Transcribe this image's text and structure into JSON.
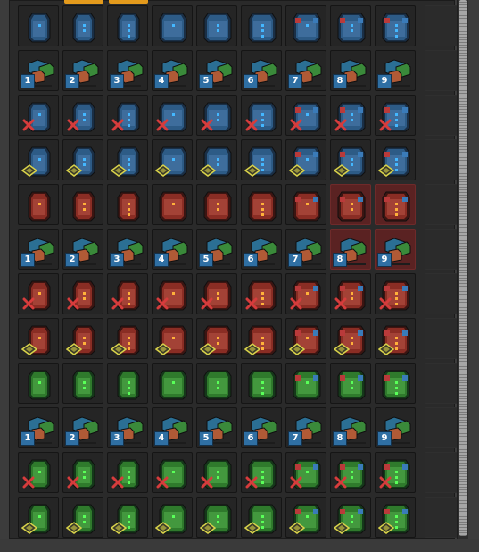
{
  "window": {
    "theme_colors": {
      "blue": "#2d5b86",
      "red": "#8a2d24",
      "green": "#2f7a2c",
      "highlight": "#5a2222",
      "badge_blue": "#2f6fa3",
      "x_red": "#d63c3c",
      "filter_yellow": "#d8d24a",
      "orange_tab": "#e39a1c"
    }
  },
  "grid": {
    "columns": 9,
    "rows": [
      {
        "kind": "chest",
        "color": "blue",
        "cells": [
          {},
          {},
          {},
          {},
          {},
          {},
          {},
          {},
          {}
        ]
      },
      {
        "kind": "logistic",
        "color": "blue",
        "cells": [
          {
            "badge": "1"
          },
          {
            "badge": "2"
          },
          {
            "badge": "3"
          },
          {
            "badge": "4"
          },
          {
            "badge": "5"
          },
          {
            "badge": "6"
          },
          {
            "badge": "7"
          },
          {
            "badge": "8"
          },
          {
            "badge": "9"
          }
        ]
      },
      {
        "kind": "chest-x",
        "color": "blue",
        "cells": [
          {},
          {},
          {},
          {},
          {},
          {},
          {},
          {},
          {}
        ]
      },
      {
        "kind": "chest-filter",
        "color": "blue",
        "cells": [
          {},
          {},
          {},
          {},
          {},
          {},
          {},
          {},
          {}
        ]
      },
      {
        "kind": "chest",
        "color": "red",
        "cells": [
          {},
          {},
          {},
          {},
          {},
          {},
          {},
          {
            "highlight": true
          },
          {
            "highlight": true
          }
        ]
      },
      {
        "kind": "logistic",
        "color": "blue",
        "cells": [
          {
            "badge": "1"
          },
          {
            "badge": "2"
          },
          {
            "badge": "3"
          },
          {
            "badge": "4"
          },
          {
            "badge": "5"
          },
          {
            "badge": "6"
          },
          {
            "badge": "7"
          },
          {
            "badge": "8",
            "highlight": true
          },
          {
            "badge": "9",
            "highlight": true
          }
        ]
      },
      {
        "kind": "chest-x",
        "color": "red",
        "cells": [
          {},
          {},
          {},
          {},
          {},
          {},
          {},
          {},
          {}
        ]
      },
      {
        "kind": "chest-filter",
        "color": "red",
        "cells": [
          {},
          {},
          {},
          {},
          {},
          {},
          {},
          {},
          {}
        ]
      },
      {
        "kind": "chest",
        "color": "green",
        "cells": [
          {},
          {},
          {},
          {},
          {},
          {},
          {},
          {},
          {}
        ]
      },
      {
        "kind": "logistic",
        "color": "blue",
        "cells": [
          {
            "badge": "1"
          },
          {
            "badge": "2"
          },
          {
            "badge": "3"
          },
          {
            "badge": "4"
          },
          {
            "badge": "5"
          },
          {
            "badge": "6"
          },
          {
            "badge": "7"
          },
          {
            "badge": "8"
          },
          {
            "badge": "9"
          }
        ]
      },
      {
        "kind": "chest-x",
        "color": "green",
        "cells": [
          {},
          {},
          {},
          {},
          {},
          {},
          {},
          {},
          {}
        ]
      },
      {
        "kind": "chest-filter",
        "color": "green",
        "cells": [
          {},
          {},
          {},
          {},
          {},
          {},
          {},
          {},
          {}
        ]
      }
    ]
  }
}
